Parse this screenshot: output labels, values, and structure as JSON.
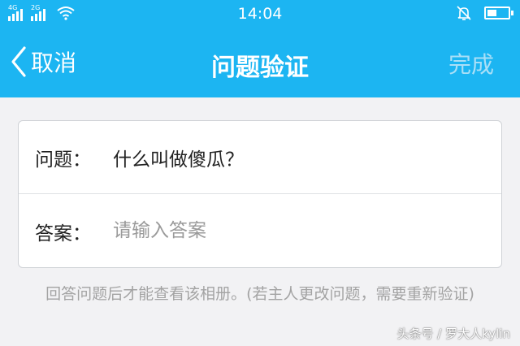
{
  "status_bar": {
    "sim1_tag": "4G",
    "sim2_tag": "2G",
    "time": "14:04"
  },
  "nav": {
    "back_label": "取消",
    "title": "问题验证",
    "done_label": "完成"
  },
  "form": {
    "question_label": "问题：",
    "question_value": "什么叫做傻瓜？",
    "answer_label": "答案：",
    "answer_placeholder": "请输入答案",
    "answer_value": ""
  },
  "hint": "回答问题后才能查看该相册。(若主人更改问题，需要重新验证)",
  "watermark": "头条号 / 罗大人kylin",
  "colors": {
    "header_bg": "#1cb5f2",
    "page_bg": "#f2f2f4",
    "done_disabled": "#a9dff7"
  },
  "icons": [
    "signal-icon",
    "wifi-icon",
    "bell-muted-icon",
    "battery-icon",
    "back-chevron-icon"
  ]
}
